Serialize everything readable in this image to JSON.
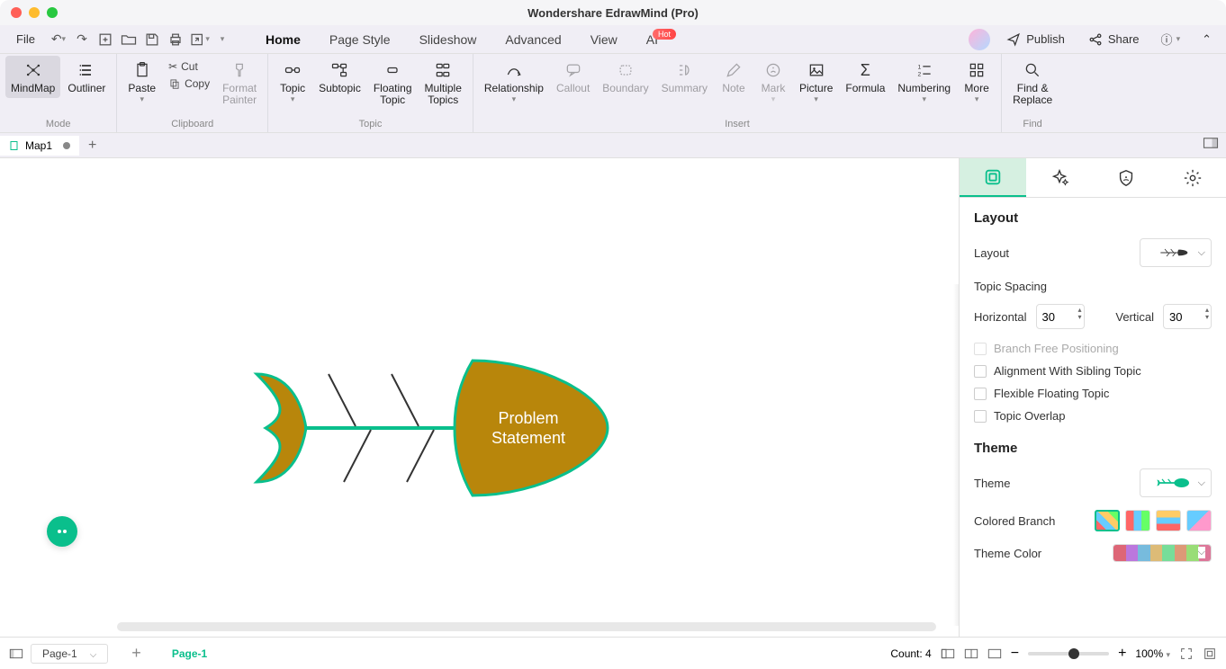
{
  "title": "Wondershare EdrawMind (Pro)",
  "file_menu": "File",
  "tabs": {
    "home": "Home",
    "page_style": "Page Style",
    "slideshow": "Slideshow",
    "advanced": "Advanced",
    "view": "View",
    "ai": "AI",
    "ai_badge": "Hot"
  },
  "menu_right": {
    "publish": "Publish",
    "share": "Share"
  },
  "ribbon": {
    "mode": {
      "mindmap": "MindMap",
      "outliner": "Outliner",
      "group": "Mode"
    },
    "clipboard": {
      "paste": "Paste",
      "cut": "Cut",
      "copy": "Copy",
      "format_painter": "Format\nPainter",
      "group": "Clipboard"
    },
    "topic": {
      "topic": "Topic",
      "subtopic": "Subtopic",
      "floating": "Floating\nTopic",
      "multiple": "Multiple\nTopics",
      "group": "Topic"
    },
    "insert": {
      "relationship": "Relationship",
      "callout": "Callout",
      "boundary": "Boundary",
      "summary": "Summary",
      "note": "Note",
      "mark": "Mark",
      "picture": "Picture",
      "formula": "Formula",
      "numbering": "Numbering",
      "more": "More",
      "group": "Insert"
    },
    "find": {
      "find_replace": "Find &\nReplace",
      "group": "Find"
    }
  },
  "doc_tabs": {
    "map1": "Map1"
  },
  "canvas": {
    "main_topic": "Problem\nStatement"
  },
  "side": {
    "layout_hdr": "Layout",
    "layout_lbl": "Layout",
    "topic_spacing": "Topic Spacing",
    "horizontal": "Horizontal",
    "h_val": "30",
    "vertical": "Vertical",
    "v_val": "30",
    "branch_free": "Branch Free Positioning",
    "align_sibling": "Alignment With Sibling Topic",
    "flex_float": "Flexible Floating Topic",
    "topic_overlap": "Topic Overlap",
    "theme_hdr": "Theme",
    "theme_lbl": "Theme",
    "colored_branch": "Colored Branch",
    "theme_color": "Theme Color"
  },
  "status": {
    "page_sel": "Page-1",
    "page_tab": "Page-1",
    "count": "Count: 4",
    "zoom": "100%"
  }
}
